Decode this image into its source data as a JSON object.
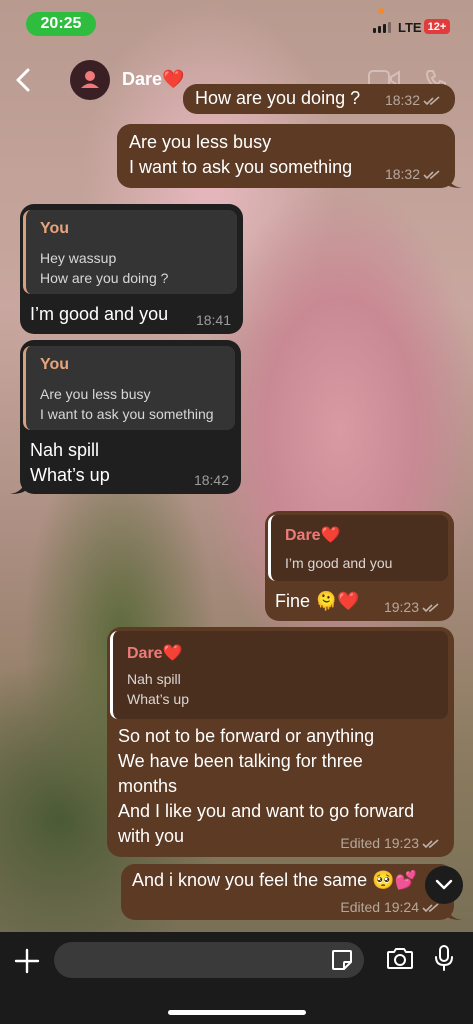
{
  "status_bar": {
    "time": "20:25",
    "network": "LTE",
    "battery": "12+",
    "colors": {
      "time_pill": "#2fbd3f",
      "battery": "#e23b3b",
      "recording_dot": "#f08a2a"
    }
  },
  "header": {
    "contact_name": "Dare❤️",
    "icons": [
      "back-chevron-icon",
      "person-icon",
      "video-call-icon",
      "phone-icon"
    ]
  },
  "messages": [
    {
      "side": "out",
      "text": "How are you doing ?",
      "time": "18:32",
      "partial": true
    },
    {
      "side": "out",
      "text": "Are you less busy\nI want to ask you something",
      "time": "18:32"
    },
    {
      "side": "in",
      "reply": {
        "name": "You",
        "text": "Hey wassup\nHow are you doing ?"
      },
      "text": "I’m good and you",
      "time": "18:41"
    },
    {
      "side": "in",
      "reply": {
        "name": "You",
        "text": "Are you less busy\nI want to ask you something"
      },
      "text": "Nah spill\nWhat’s up",
      "time": "18:42"
    },
    {
      "side": "out",
      "reply": {
        "name": "Dare❤️",
        "text": "I’m good and you"
      },
      "text": "Fine 🫠❤️",
      "time": "19:23"
    },
    {
      "side": "out",
      "reply": {
        "name": "Dare❤️",
        "text": "Nah spill\nWhat’s up"
      },
      "text": "So not to be forward or anything\nWe have been talking for three\nmonths\nAnd I like you and want to go forward\nwith you",
      "time": "Edited 19:23"
    },
    {
      "side": "out",
      "text": "And i know you feel the same 🥺💕",
      "time": "Edited 19:24"
    }
  ],
  "composer": {
    "placeholder": "",
    "icons": [
      "plus-icon",
      "sticker-icon",
      "camera-icon",
      "microphone-icon"
    ]
  },
  "colors": {
    "outgoing_bubble": "#5c3a24",
    "incoming_bubble": "#1f1f1f",
    "reply_you": "#e8a47c",
    "reply_dare": "#f07a7a"
  }
}
